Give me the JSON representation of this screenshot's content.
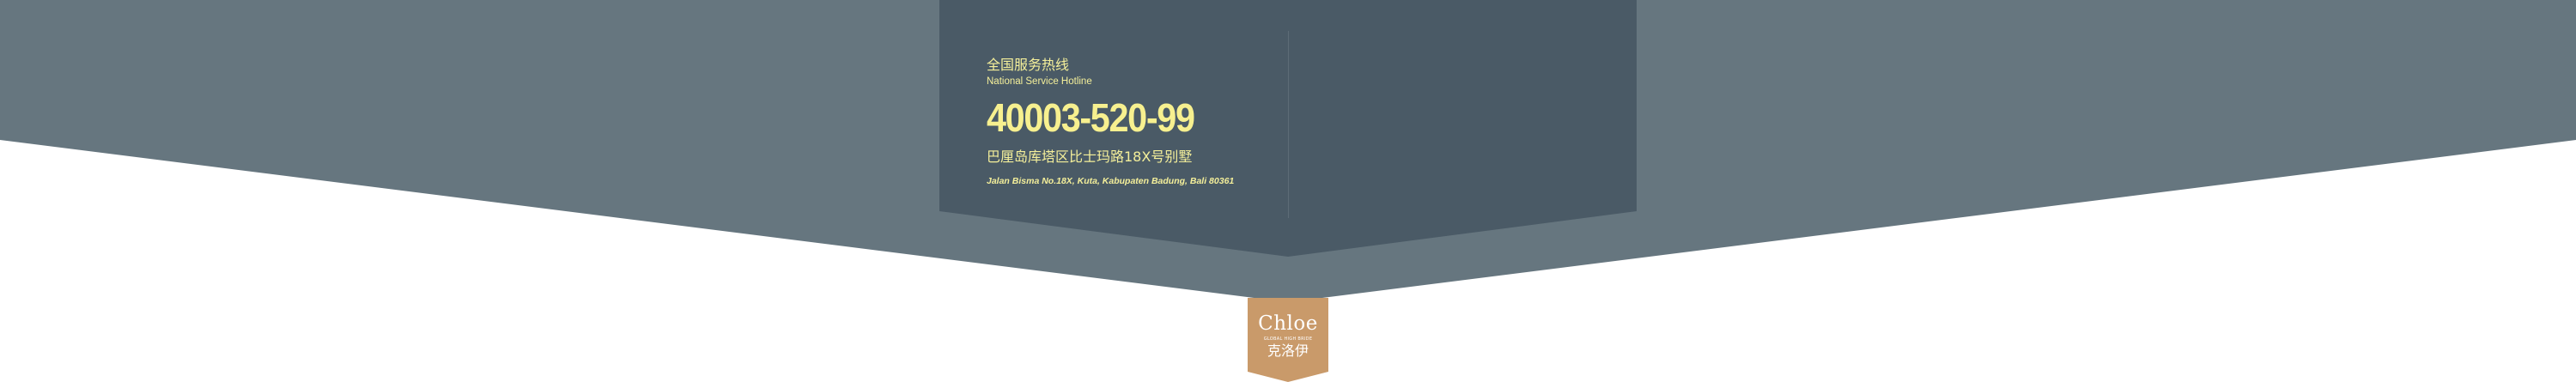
{
  "colors": {
    "outer_band": "#66767f",
    "inner_panel": "#4a5a66",
    "accent_text": "#f4ef9a",
    "logo_bg": "#c99a6a"
  },
  "contact": {
    "hotline_cn": "全国服务热线",
    "hotline_en": "National Service Hotline",
    "phone": "40003-520-99",
    "address_cn": "巴厘岛库塔区比士玛路18X号别墅",
    "address_en": "Jalan Bisma No.18X, Kuta, Kabupaten Badung, Bali 80361"
  },
  "logo": {
    "word": "Chloe",
    "sub": "GLOBAL HIGH BRIDE",
    "cn": "克洛伊"
  }
}
